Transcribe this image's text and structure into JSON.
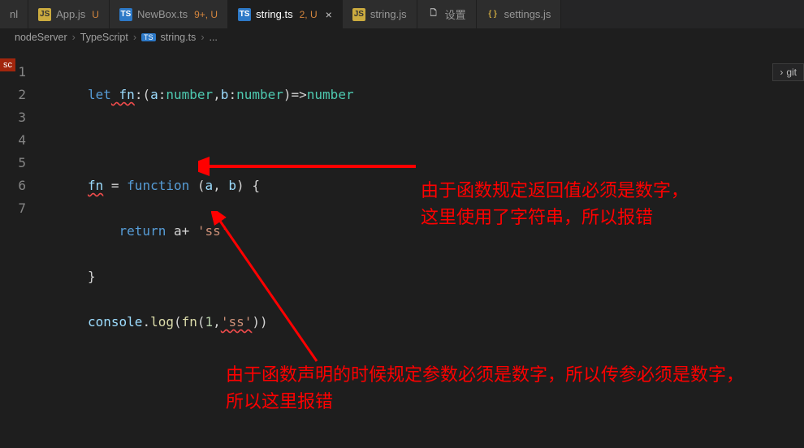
{
  "tabs": [
    {
      "icon": "nl",
      "label": "nl",
      "mod": ""
    },
    {
      "icon": "js",
      "label": "App.js",
      "mod": "U"
    },
    {
      "icon": "ts",
      "label": "NewBox.ts",
      "mod": "9+, U"
    },
    {
      "icon": "ts",
      "label": "string.ts",
      "mod": "2, U",
      "active": true,
      "close": true
    },
    {
      "icon": "js",
      "label": "string.js",
      "mod": ""
    },
    {
      "icon": "file",
      "label": "设置",
      "mod": ""
    },
    {
      "icon": "braces",
      "label": "settings.js",
      "mod": ""
    }
  ],
  "breadcrumb": {
    "p0": "nodeServer",
    "p1": "TypeScript",
    "iconLabel": "TS",
    "p2": "string.ts",
    "p3": "..."
  },
  "sc_badge": "sc",
  "git_label": "git",
  "line_numbers": [
    "1",
    "2",
    "3",
    "4",
    "5",
    "6",
    "7"
  ],
  "code": {
    "l1": {
      "t0": "let",
      "t1": " fn",
      "t2": ":(",
      "t3": "a",
      "t4": ":",
      "t5": "number",
      "t6": ",",
      "t7": "b",
      "t8": ":",
      "t9": "number",
      "t10": ")=>",
      "t11": "number"
    },
    "l3": {
      "t0": "fn",
      "t1": " = ",
      "t2": "function",
      "t3": " (",
      "t4": "a",
      "t5": ", ",
      "t6": "b",
      "t7": ") {"
    },
    "l4": {
      "t0": "    ",
      "t1": "return",
      "t2": " a+ ",
      "t3": "'ss'"
    },
    "l5": {
      "t0": "}"
    },
    "l6": {
      "t0": "console",
      "t1": ".",
      "t2": "log",
      "t3": "(",
      "t4": "fn",
      "t5": "(",
      "t6": "1",
      "t7": ",",
      "t8": "'ss'",
      "t9": "))"
    }
  },
  "annotations": {
    "a1": "由于函数规定返回值必须是数字，这里使用了字符串，所以报错",
    "a2": "由于函数声明的时候规定参数必须是数字，所以传参必须是数字，所以这里报错"
  }
}
